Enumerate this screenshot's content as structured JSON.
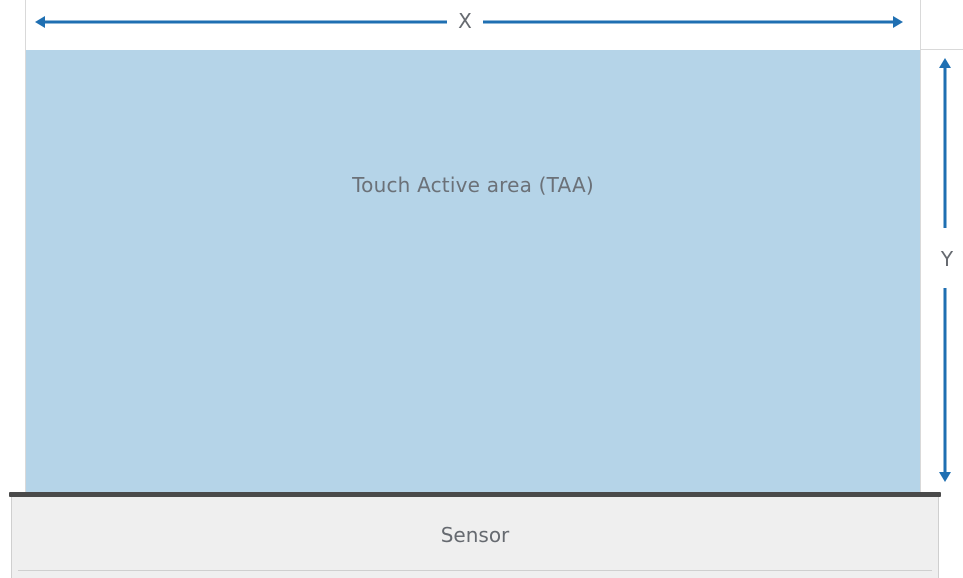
{
  "diagram": {
    "width_dimension_label": "X",
    "height_dimension_label": "Y",
    "touch_area_label": "Touch Active area (TAA)",
    "sensor_label": "Sensor"
  },
  "colors": {
    "touch_area_fill": "#b5d4e8",
    "arrow_color": "#1f6fb2",
    "sensor_fill": "#efefef",
    "sensor_edge": "#4a4a4a",
    "label_text": "#666a70"
  }
}
